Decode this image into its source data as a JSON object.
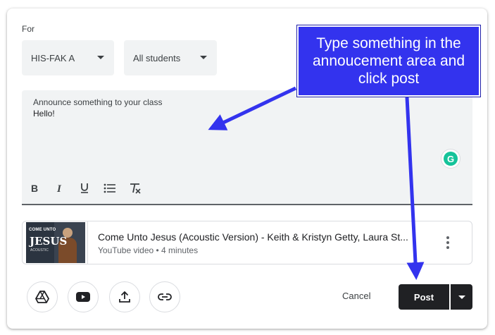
{
  "form": {
    "for_label": "For",
    "class_select": "HIS-FAK A",
    "audience_select": "All students"
  },
  "compose": {
    "label": "Announce something to your class",
    "text": "Hello!",
    "grammarly_letter": "G",
    "toolbar": [
      "bold-icon",
      "italic-icon",
      "underline-icon",
      "bulleted-list-icon",
      "clear-formatting-icon"
    ]
  },
  "attachment": {
    "title": "Come Unto Jesus (Acoustic Version) - Keith & Kristyn Getty, Laura St...",
    "subtitle": "YouTube video • 4 minutes",
    "thumb_line1": "COME UNTO",
    "thumb_line2": "JESUS",
    "thumb_line3": "ACOUSTIC"
  },
  "actions": {
    "icons": [
      "google-drive-icon",
      "youtube-icon",
      "upload-icon",
      "link-icon"
    ],
    "cancel_label": "Cancel",
    "post_label": "Post"
  },
  "callout": {
    "text": "Type something in the annoucement area and click post",
    "color": "#3333ee"
  }
}
